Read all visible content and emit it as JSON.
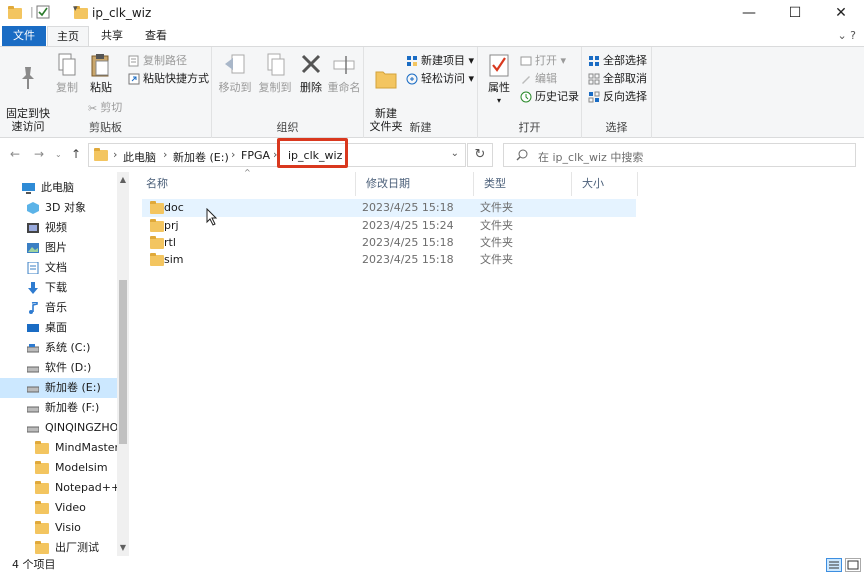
{
  "window": {
    "title": "ip_clk_wiz",
    "minimize": "—",
    "maximize": "☐",
    "close": "✕"
  },
  "tabs": [
    {
      "label": "文件"
    },
    {
      "label": "主页"
    },
    {
      "label": "共享"
    },
    {
      "label": "查看"
    }
  ],
  "tabs_right": "⌄  ?",
  "ribbon": {
    "clipboard": {
      "label": "剪贴板",
      "pin": "固定到快\n速访问",
      "copy": "复制",
      "paste": "粘贴",
      "copy_path": "复制路径",
      "paste_shortcut": "粘贴快捷方式",
      "cut": "剪切"
    },
    "organize": {
      "label": "组织",
      "move_to": "移动到",
      "copy_to": "复制到",
      "delete": "删除",
      "rename": "重命名"
    },
    "new": {
      "label": "新建",
      "new_folder": "新建\n文件夹",
      "new_item": "新建项目 ▾",
      "easy_access": "轻松访问 ▾"
    },
    "open": {
      "label": "打开",
      "properties": "属性",
      "open": "打开 ▾",
      "edit": "编辑",
      "history": "历史记录"
    },
    "select": {
      "label": "选择",
      "select_all": "全部选择",
      "select_none": "全部取消",
      "invert": "反向选择"
    }
  },
  "address": {
    "breadcrumbs": [
      "此电脑",
      "新加卷 (E:)",
      "FPGA",
      "ip_clk_wiz"
    ],
    "search_placeholder": "在 ip_clk_wiz 中搜索"
  },
  "nav": {
    "items": [
      {
        "label": "此电脑",
        "icon": "computer-icon"
      },
      {
        "label": "3D 对象",
        "icon": "cube-icon"
      },
      {
        "label": "视频",
        "icon": "video-icon"
      },
      {
        "label": "图片",
        "icon": "picture-icon"
      },
      {
        "label": "文档",
        "icon": "document-icon"
      },
      {
        "label": "下载",
        "icon": "download-icon"
      },
      {
        "label": "音乐",
        "icon": "music-icon"
      },
      {
        "label": "桌面",
        "icon": "desktop-icon"
      },
      {
        "label": "系统 (C:)",
        "icon": "drive-icon"
      },
      {
        "label": "软件 (D:)",
        "icon": "drive-icon"
      },
      {
        "label": "新加卷 (E:)",
        "icon": "drive-icon"
      },
      {
        "label": "新加卷 (F:)",
        "icon": "drive-icon"
      },
      {
        "label": "QINQINGZHOU",
        "icon": "drive-icon"
      },
      {
        "label": "MindMaster",
        "icon": "folder-icon"
      },
      {
        "label": "Modelsim",
        "icon": "folder-icon"
      },
      {
        "label": "Notepad++",
        "icon": "folder-icon"
      },
      {
        "label": "Video",
        "icon": "folder-icon"
      },
      {
        "label": "Visio",
        "icon": "folder-icon"
      },
      {
        "label": "出厂测试",
        "icon": "folder-icon"
      }
    ]
  },
  "list": {
    "columns": [
      "名称",
      "修改日期",
      "类型",
      "大小"
    ],
    "rows": [
      {
        "name": "doc",
        "date": "2023/4/25 15:18",
        "type": "文件夹",
        "size": ""
      },
      {
        "name": "prj",
        "date": "2023/4/25 15:24",
        "type": "文件夹",
        "size": ""
      },
      {
        "name": "rtl",
        "date": "2023/4/25 15:18",
        "type": "文件夹",
        "size": ""
      },
      {
        "name": "sim",
        "date": "2023/4/25 15:18",
        "type": "文件夹",
        "size": ""
      }
    ]
  },
  "status": {
    "count": "4 个项目"
  },
  "colors": {
    "accent": "#1a6cc4",
    "selection": "#cce8ff",
    "hover": "#e5f3ff",
    "highlight_box": "#d9381e",
    "folder": "#f3c560"
  }
}
